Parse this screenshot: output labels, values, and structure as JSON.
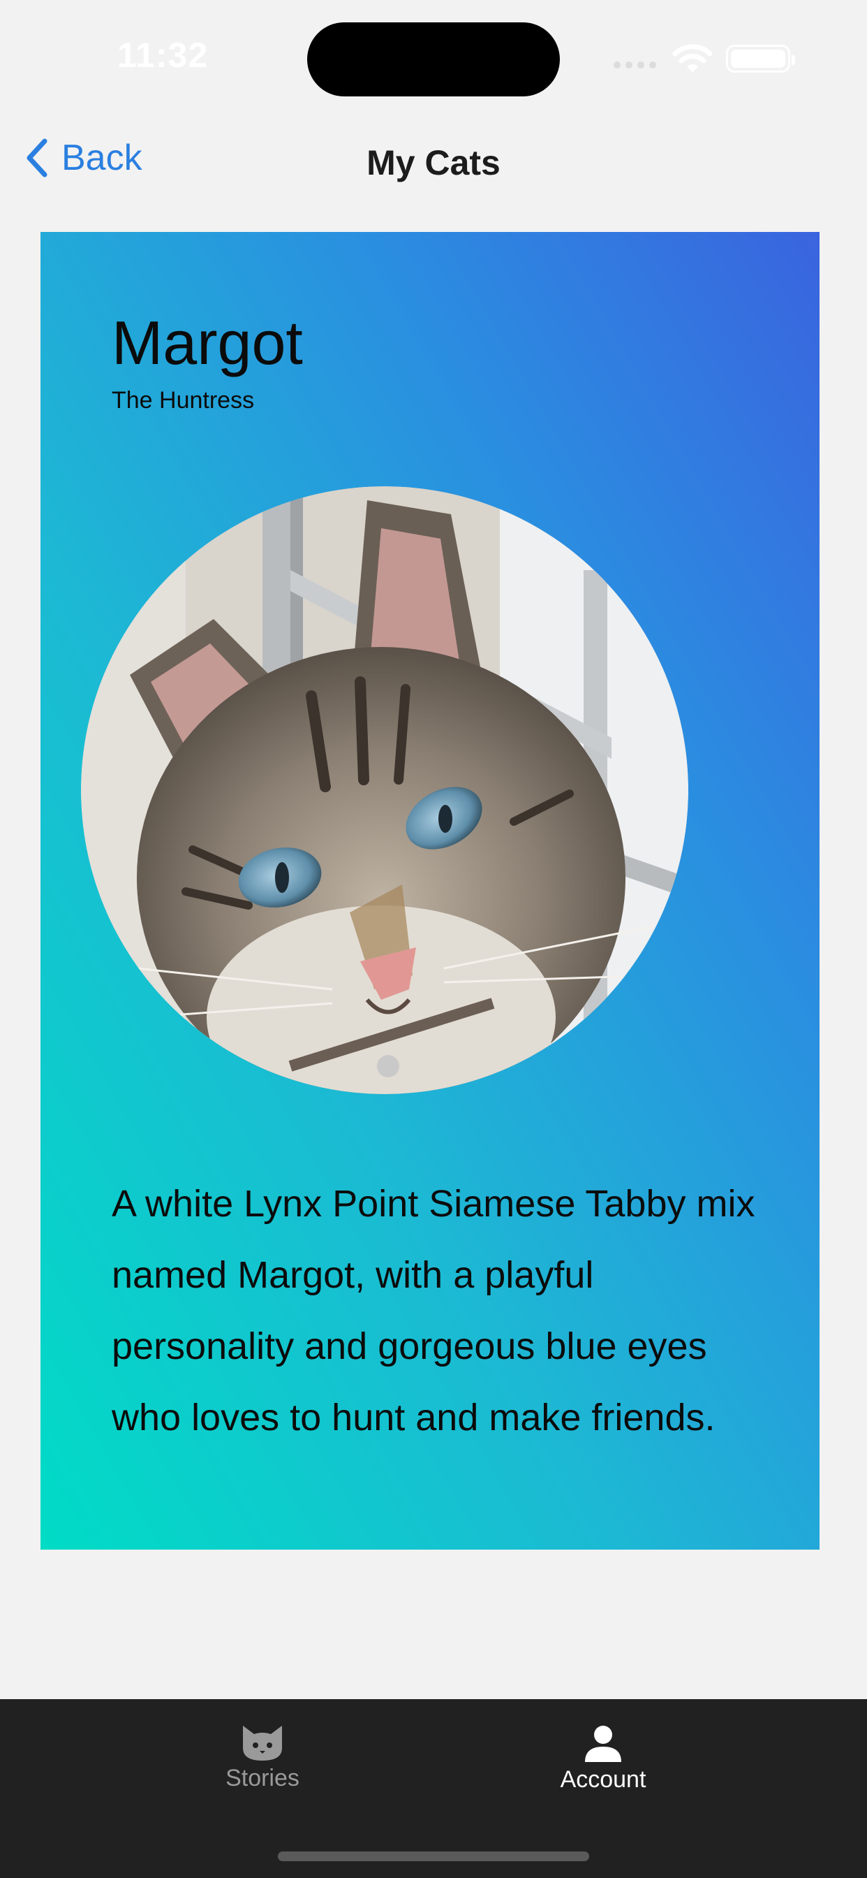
{
  "status_bar": {
    "time": "11:32"
  },
  "nav": {
    "back_label": "Back",
    "title": "My Cats"
  },
  "card": {
    "name": "Margot",
    "subtitle": "The Huntress",
    "description": "A white Lynx Point Siamese Tabby mix named Margot, with a playful personality and gorgeous blue eyes who loves to hunt and make friends.",
    "gradient_colors": [
      "#00dcc6",
      "#1db8d4",
      "#2a8fe0",
      "#3a64df"
    ]
  },
  "tab_bar": {
    "tabs": [
      {
        "label": "Stories",
        "icon": "cat-face-icon",
        "selected": false
      },
      {
        "label": "Account",
        "icon": "person-icon",
        "selected": true
      }
    ],
    "background": "#212121"
  },
  "colors": {
    "accent": "#2a7fe0",
    "page_background": "#f2f2f2"
  }
}
